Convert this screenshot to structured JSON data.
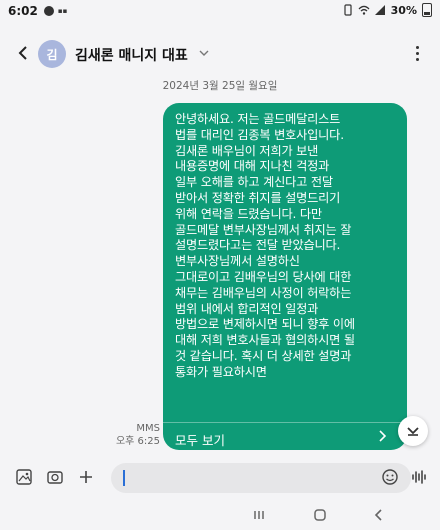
{
  "status_bar": {
    "time": "6:02",
    "battery": "30%",
    "left_icons": [
      "messenger-icon",
      "notification-icon"
    ],
    "right_icons": [
      "vibrate-icon",
      "wifi-icon",
      "signal-icon",
      "battery-icon"
    ]
  },
  "header": {
    "avatar_initial": "김",
    "contact_name": "김새론 매니지 대표",
    "icons": [
      "back-arrow-icon",
      "chevron-down-icon",
      "more-vert-icon"
    ]
  },
  "conversation": {
    "date_separator": "2024년 3월 25일 월요일",
    "messages": [
      {
        "type": "MMS",
        "time": "오후 6:25",
        "text": "안녕하세요.  저는 골드메달리스트\n법를 대리인 김종복 변호사입니다.\n김새론 배우님이 저희가 보낸\n내용증명에 대해 지나친 걱정과\n일부 오해를 하고 계신다고 전달\n받아서 정확한 취지를 설명드리기\n위해 연락을 드렸습니다. 다만\n골드메달 변부사장님께서 취지는 잘\n설명드렸다고는 전달 받았습니다.\n변부사장님께서 설명하신\n그대로이고 김배우님의 당사에 대한\n채무는 김배우님의 사정이 허락하는\n범위 내에서 합리적인 일정과\n방법으로 변제하시면 되니 향후 이에\n대해 저희 변호사들과 협의하시면  될\n것 같습니다. 혹시 더 상세한 설명과\n통화가 필요하시면",
        "view_all_label": "모두 보기"
      }
    ]
  },
  "input_bar": {
    "value": "",
    "icons": [
      "gallery-icon",
      "camera-icon",
      "plus-icon",
      "emoji-icon",
      "voice-icon"
    ]
  },
  "nav_bar": {
    "icons": [
      "recent-apps-icon",
      "home-icon",
      "back-icon"
    ]
  },
  "colors": {
    "background": "#f4f4f6",
    "bubble": "#0e9b77",
    "avatar": "#a9b6dd",
    "caret": "#2a6fd6"
  }
}
